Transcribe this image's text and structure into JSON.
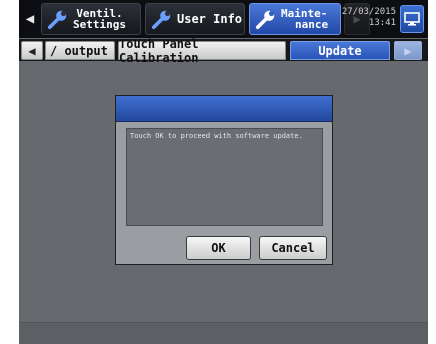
{
  "header": {
    "prev_arrow": "◀",
    "tabs": [
      {
        "line1": "Ventil.",
        "line2": "Settings"
      },
      {
        "label": "User Info"
      },
      {
        "line1": "Mainte-",
        "line2": "nance"
      }
    ],
    "next_arrow": "▶",
    "date": "27/03/2015",
    "time": "13:41"
  },
  "subtabs": {
    "prev_arrow": "◀",
    "items": [
      "/ output",
      "Touch Panel Calibration",
      "Update"
    ],
    "next_arrow": "▶"
  },
  "dialog": {
    "message": "Touch OK to proceed with software update.",
    "ok_label": "OK",
    "cancel_label": "Cancel"
  },
  "colors": {
    "accent_blue": "#2c58c0",
    "background": "#666a6e"
  }
}
